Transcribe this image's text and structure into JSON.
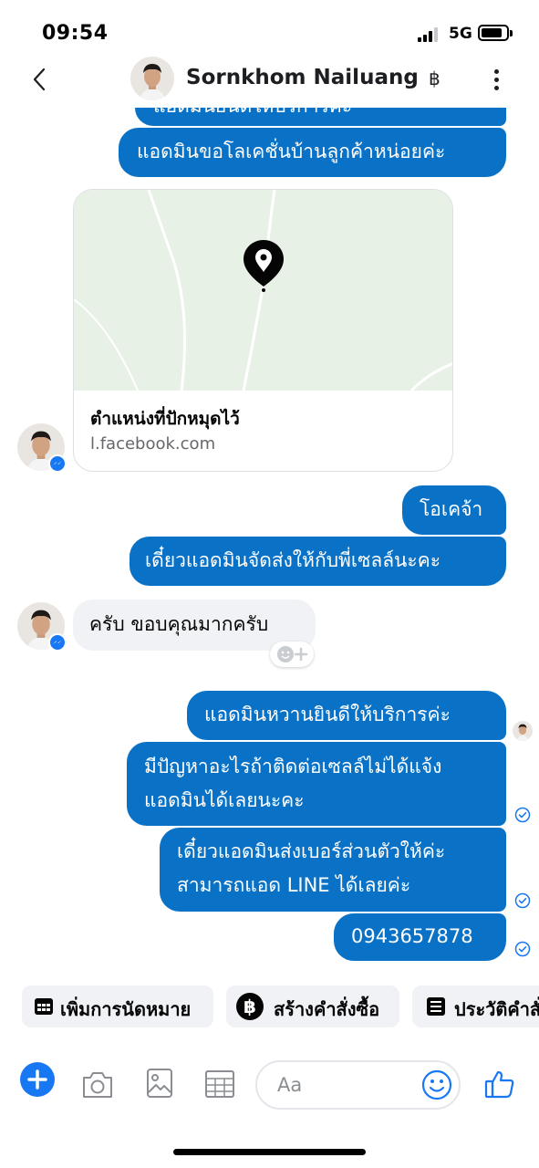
{
  "status_bar": {
    "time": "09:54",
    "network": "5G"
  },
  "header": {
    "contact_name": "Sornkhom Nailuang",
    "currency_symbol": "฿"
  },
  "messages": {
    "m0_partial": "แอดมินยินดีให้บริการค่ะ",
    "m1": "แอดมินขอโลเคชั่นบ้านลูกค้าหน่อยค่ะ",
    "map_card": {
      "title": "ตำแหน่งที่ปักหมุดไว้",
      "url": "l.facebook.com"
    },
    "m2": "โอเคจ้า",
    "m3": "เดี๋ยวแอดมินจัดส่งให้กับพี่เซลล์นะคะ",
    "m4_incoming": "ครับ ขอบคุณมากครับ",
    "m5": "แอดมินหวานยินดีให้บริการค่ะ",
    "m6": {
      "line1": "มีปัญหาอะไรถ้าติดต่อเซลล์ไม่ได้แจ้ง",
      "line2": "แอดมินได้เลยนะคะ"
    },
    "m7": {
      "line1": "เดี๋ยวแอดมินส่งเบอร์ส่วนตัวให้ค่ะ",
      "line2": "สามารถแอด LINE ได้เลยค่ะ"
    },
    "m8": "0943657878"
  },
  "quick_actions": {
    "appointment": "เพิ่มการนัดหมาย",
    "create_order": "สร้างคำสั่งซื้อ",
    "order_history": "ประวัติคำสั่งซื้อ"
  },
  "composer": {
    "placeholder": "Aa"
  },
  "colors": {
    "outgoing_bubble": "#0a72c6",
    "incoming_bubble": "#f0f2f5",
    "accent": "#1877f2"
  },
  "icons": [
    "back-icon",
    "more-icon",
    "messenger-badge-icon",
    "map-pin-icon",
    "add-reaction-icon",
    "check-circle-icon",
    "calendar-icon",
    "baht-icon",
    "list-icon",
    "plus-icon",
    "camera-icon",
    "image-icon",
    "keypad-icon",
    "emoji-icon",
    "thumbs-up-icon"
  ]
}
